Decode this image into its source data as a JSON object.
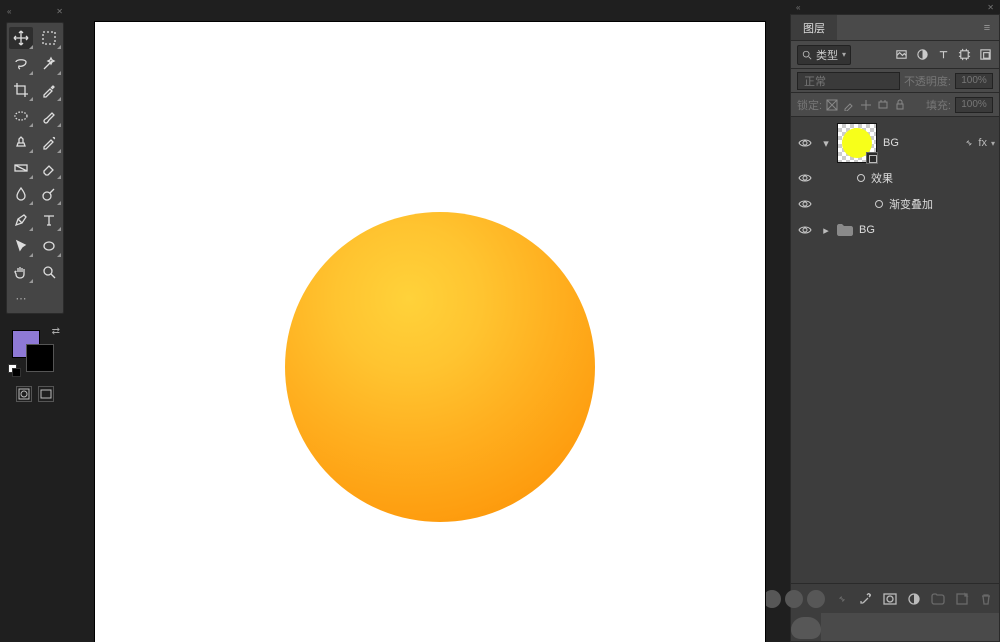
{
  "tools": {
    "move": "Move",
    "artboard": "Artboard",
    "lasso": "Lasso",
    "magicwand": "Magic Wand",
    "crop": "Crop",
    "eyedrop": "Eyedropper",
    "frame": "Frame",
    "brush": "Brush",
    "clone": "Clone",
    "eraser": "Eraser",
    "gradient": "Gradient",
    "dodge": "Dodge",
    "pen": "Pen",
    "type": "Type",
    "path": "Path",
    "ellipse": "Ellipse",
    "hand": "Hand",
    "zoom": "Zoom"
  },
  "colors": {
    "foreground": "#8e79d6",
    "background": "#000000"
  },
  "panel": {
    "tab": "图层",
    "filter_kind": "类型",
    "blend_mode": "正常",
    "opacity_label": "不透明度:",
    "opacity_value": "100%",
    "lock_label": "锁定:",
    "fill_label": "填充:",
    "fill_value": "100%"
  },
  "layers": [
    {
      "id": "bg-shape",
      "name": "BG",
      "kind": "shape",
      "visible": true,
      "fx": "fx",
      "expanded": true
    },
    {
      "id": "fx-head",
      "name": "效果",
      "kind": "fx-header",
      "visible": true
    },
    {
      "id": "fx-grad",
      "name": "渐变叠加",
      "kind": "fx-item",
      "visible": true
    },
    {
      "id": "bg-group",
      "name": "BG",
      "kind": "group",
      "visible": true
    }
  ]
}
